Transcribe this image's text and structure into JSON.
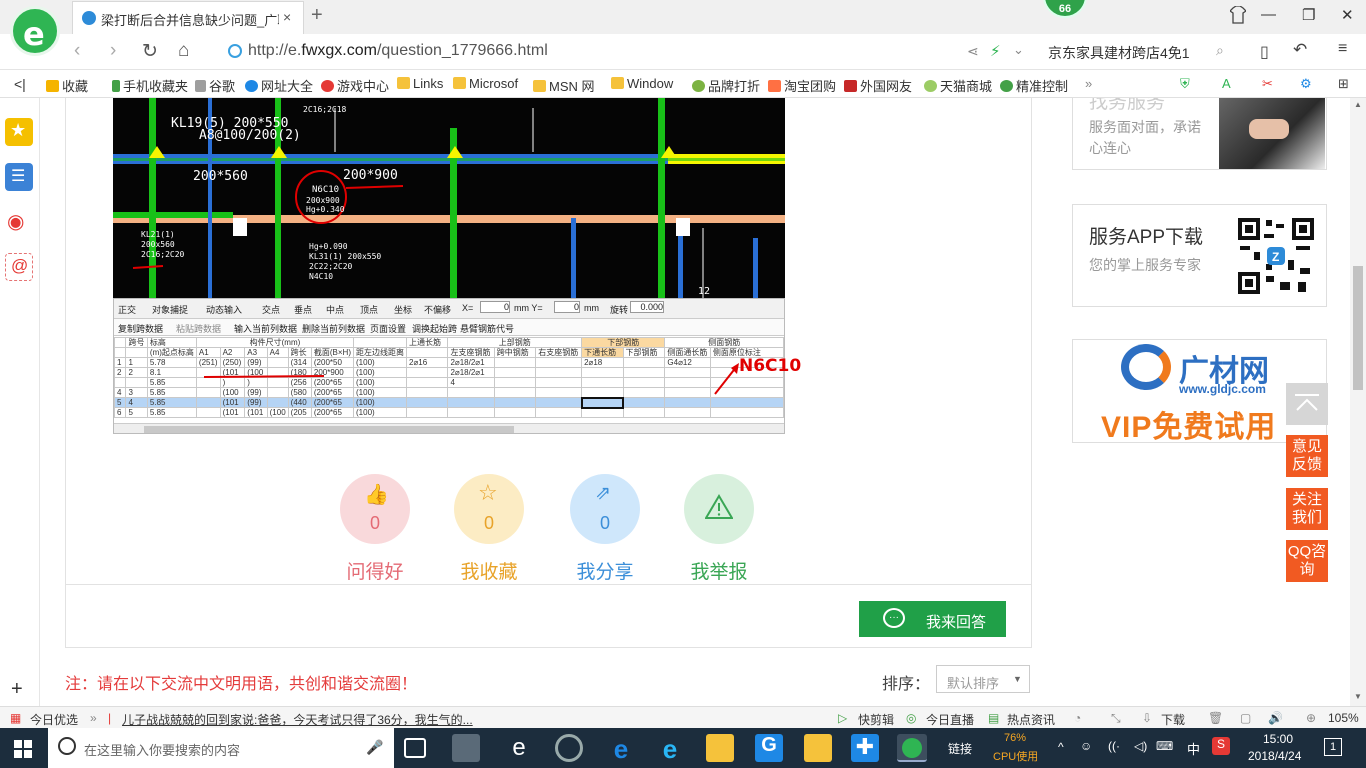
{
  "browser": {
    "tab_title": "梁打断后合并信息缺少问题_广联",
    "tab_close": "×",
    "new_tab": "+",
    "badge_count": "66",
    "url_prefix": "http://e.",
    "url_domain": "fwxgx.com",
    "url_path": "/question_1779666.html",
    "search_text": "京东家具建材跨店4免1"
  },
  "favorites": [
    {
      "label": "收藏",
      "color": "#f5b400"
    },
    {
      "label": "手机收藏夹",
      "color": "#43a047"
    },
    {
      "label": "谷歌",
      "color": "#9e9e9e"
    },
    {
      "label": "网址大全",
      "color": "#1e88e5"
    },
    {
      "label": "游戏中心",
      "color": "#e53935"
    },
    {
      "label": "Links",
      "color": "#f5c23b"
    },
    {
      "label": "Microsof",
      "color": "#f5c23b"
    },
    {
      "label": "MSN 网",
      "color": "#f5c23b"
    },
    {
      "label": "Window",
      "color": "#f5c23b"
    },
    {
      "label": "品牌打折",
      "color": "#7cb342"
    },
    {
      "label": "淘宝团购",
      "color": "#ff7043"
    },
    {
      "label": "外国网友",
      "color": "#c62828"
    },
    {
      "label": "天猫商城",
      "color": "#9ccc65"
    },
    {
      "label": "精准控制",
      "color": "#43a047"
    }
  ],
  "question": {
    "cad_labels": [
      "KL19(5) 200*550",
      "A8@100/200(2)",
      "2C16;2C18",
      "N6C10",
      "200x900",
      "Hg+0.340",
      "KL21(1)",
      "200x560",
      "2C16;2C20",
      "KL31(1) 200x550",
      "2C22;2C20",
      "N4C10",
      "200*900",
      "200*560",
      "Hg+0.090",
      "12"
    ],
    "grid_toolbar": [
      "正交",
      "对象捕捉",
      "动态输入",
      "交点",
      "垂点",
      "中点",
      "顶点",
      "坐标",
      "不偏移",
      "X=",
      "0",
      "mm Y=",
      "0",
      "mm",
      "旋转",
      "0.000"
    ],
    "grid_toolbar2": [
      "复制跨数据",
      "粘贴跨数据",
      "输入当前列数据",
      "删除当前列数据",
      "页面设置",
      "调换起始跨",
      "悬臂钢筋代号"
    ],
    "grid_head1": [
      "跨号",
      "标高",
      "构件尺寸(mm)",
      "",
      "",
      "",
      "",
      "",
      "上通长筋",
      "上部钢筋",
      "",
      "",
      "下部钢筋",
      "",
      "侧面钢筋",
      ""
    ],
    "grid_head2": [
      "",
      "(m)起点标高",
      "A1",
      "A2",
      "A3",
      "A4",
      "跨长",
      "截面(B×H)",
      "距左边线距离",
      "",
      "左支座钢筋",
      "跨中钢筋",
      "右支座钢筋",
      "下通长筋",
      "下部钢筋",
      "侧面通长筋",
      "侧面原位标注"
    ],
    "grid_rows": [
      [
        "1",
        "1",
        "5.78",
        "(251)",
        "(250)",
        "(99)",
        "",
        "(314",
        "(200*50",
        "(100)",
        "2⌀16",
        "2⌀18/2⌀1",
        "",
        "",
        "2⌀18",
        "",
        "G4⌀12",
        ""
      ],
      [
        "2",
        "2",
        "8.1",
        "",
        "(101",
        "(100",
        "",
        "(180",
        "200*900",
        "(100)",
        "",
        "2⌀18/2⌀1",
        "",
        "",
        "",
        "",
        "",
        ""
      ],
      [
        "",
        "",
        "5.85",
        "",
        ")",
        ")",
        "",
        "(256",
        "(200*65",
        "(100)",
        "",
        "4",
        "",
        "",
        "",
        "",
        "",
        ""
      ],
      [
        "4",
        "3",
        "5.85",
        "",
        "(100",
        "(99)",
        "",
        "(580",
        "(200*65",
        "(100)",
        "",
        "",
        "",
        "",
        "",
        "",
        "",
        ""
      ],
      [
        "5",
        "4",
        "5.85",
        "",
        "(101",
        "(99)",
        "",
        "(440",
        "(200*65",
        "(100)",
        "",
        "",
        "",
        "",
        "",
        "",
        "",
        ""
      ],
      [
        "6",
        "5",
        "5.85",
        "",
        "(101",
        "(101",
        "(100",
        "(205",
        "(200*65",
        "(100)",
        "",
        "",
        "",
        "",
        "",
        "",
        "",
        ""
      ]
    ],
    "annotation": "N6C10"
  },
  "actions": [
    {
      "label": "问得好",
      "count": "0",
      "bg": "#f9d9db",
      "fg": "#e46a74"
    },
    {
      "label": "我收藏",
      "count": "0",
      "bg": "#fcecc4",
      "fg": "#e8a32a"
    },
    {
      "label": "我分享",
      "count": "0",
      "bg": "#cfe7fb",
      "fg": "#3c8fd9"
    },
    {
      "label": "我举报",
      "count": "",
      "bg": "#d8f0dd",
      "fg": "#3aa655"
    }
  ],
  "answer_button": "我来回答",
  "note": "注：请在以下交流中文明用语，共创和谐交流圈！",
  "sort": {
    "label": "排序：",
    "value": "默认排序"
  },
  "right": {
    "service_title": "找务服务",
    "service_sub": "服务面对面，承诺心连心",
    "app_title": "服务APP下载",
    "app_sub": "您的掌上服务专家",
    "ad_brand": "广材网",
    "ad_url": "www.gldjc.com",
    "ad_vip": "VIP免费试用",
    "buttons": [
      "意见反馈",
      "关注我们",
      "QQ咨询"
    ]
  },
  "statusbar": {
    "left": "今日优选",
    "news": "儿子战战兢兢的回到家说:爸爸，今天考试只得了36分，我生气的...",
    "items": [
      "快剪辑",
      "今日直播",
      "热点资讯",
      "下载"
    ],
    "zoom": "105%"
  },
  "taskbar": {
    "search_placeholder": "在这里输入你要搜索的内容",
    "link_label": "链接",
    "cpu_percent": "76%",
    "cpu_label": "CPU使用",
    "ime": "中",
    "time": "15:00",
    "date": "2018/4/24",
    "notif": "1"
  }
}
